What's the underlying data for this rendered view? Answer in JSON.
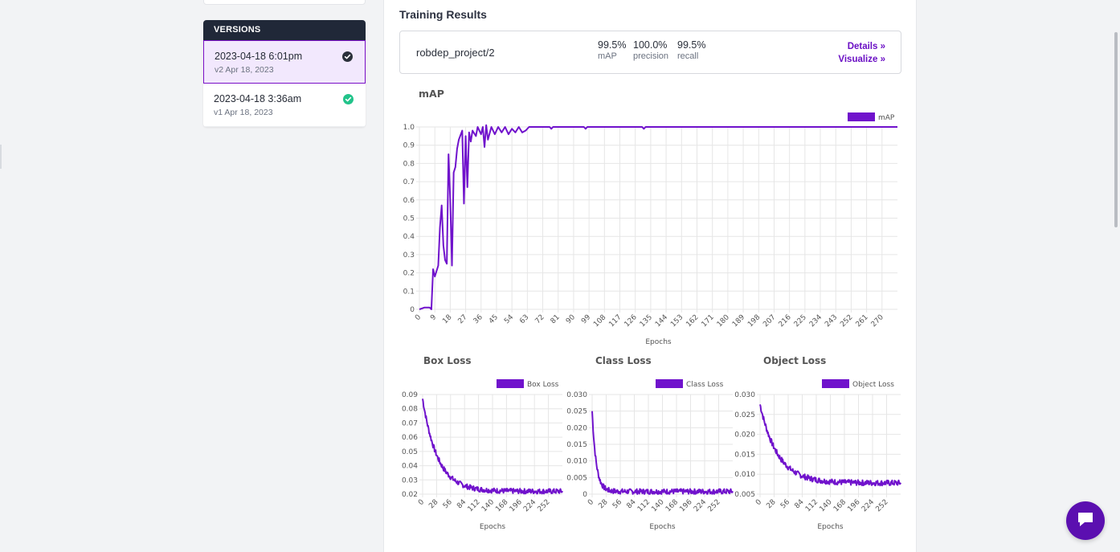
{
  "sidebar": {
    "versions_header": "VERSIONS",
    "versions": [
      {
        "date": "2023-04-18 6:01pm",
        "sub": "v2 Apr 18, 2023",
        "status": "selected"
      },
      {
        "date": "2023-04-18 3:36am",
        "sub": "v1 Apr 18, 2023",
        "status": "done"
      }
    ]
  },
  "main": {
    "title": "Training Results",
    "result": {
      "project": "robdep_project/2",
      "metrics": [
        {
          "value": "99.5%",
          "label": "mAP"
        },
        {
          "value": "100.0%",
          "label": "precision"
        },
        {
          "value": "99.5%",
          "label": "recall"
        }
      ],
      "details_link": "Details »",
      "visualize_link": "Visualize »"
    }
  },
  "colors": {
    "accent": "#6a0fc4",
    "line": "#7012cc",
    "header": "#202838",
    "success": "#22c38a"
  },
  "chart_data": [
    {
      "type": "line",
      "title": "mAP",
      "xlabel": "Epochs",
      "ylabel": "",
      "legend": "mAP",
      "legend_position": "top-right",
      "ylim": [
        0,
        1.0
      ],
      "yticks": [
        "0",
        "0.1",
        "0.2",
        "0.3",
        "0.4",
        "0.5",
        "0.6",
        "0.7",
        "0.8",
        "0.9",
        "1.0"
      ],
      "xticks": [
        "0",
        "9",
        "18",
        "27",
        "36",
        "45",
        "54",
        "63",
        "72",
        "81",
        "90",
        "99",
        "108",
        "117",
        "126",
        "135",
        "144",
        "153",
        "162",
        "171",
        "180",
        "189",
        "198",
        "207",
        "216",
        "225",
        "234",
        "243",
        "252",
        "261",
        "270"
      ],
      "xmax": 279,
      "points": [
        [
          0,
          0.0
        ],
        [
          3,
          0.01
        ],
        [
          6,
          0.01
        ],
        [
          7,
          0.0
        ],
        [
          8,
          0.22
        ],
        [
          9,
          0.18
        ],
        [
          11,
          0.24
        ],
        [
          12,
          0.45
        ],
        [
          13,
          0.57
        ],
        [
          14,
          0.35
        ],
        [
          15,
          0.27
        ],
        [
          16,
          0.25
        ],
        [
          17,
          0.85
        ],
        [
          18,
          0.6
        ],
        [
          19,
          0.24
        ],
        [
          20,
          0.75
        ],
        [
          21,
          0.78
        ],
        [
          22,
          0.88
        ],
        [
          23,
          0.93
        ],
        [
          25,
          0.98
        ],
        [
          26,
          0.58
        ],
        [
          27,
          0.95
        ],
        [
          28,
          0.67
        ],
        [
          29,
          0.97
        ],
        [
          30,
          0.92
        ],
        [
          31,
          0.98
        ],
        [
          33,
          0.95
        ],
        [
          34,
          1.0
        ],
        [
          36,
          0.96
        ],
        [
          37,
          1.0
        ],
        [
          38,
          0.89
        ],
        [
          39,
          1.01
        ],
        [
          40,
          0.93
        ],
        [
          42,
          1.0
        ],
        [
          44,
          0.96
        ],
        [
          46,
          1.0
        ],
        [
          48,
          0.97
        ],
        [
          50,
          1.0
        ],
        [
          52,
          0.96
        ],
        [
          54,
          0.99
        ],
        [
          56,
          0.97
        ],
        [
          58,
          1.0
        ],
        [
          60,
          0.97
        ],
        [
          62,
          0.98
        ],
        [
          64,
          1.0
        ],
        [
          72,
          1.0
        ],
        [
          76,
          1.0
        ],
        [
          77,
          0.99
        ],
        [
          78,
          1.0
        ],
        [
          96,
          1.0
        ],
        [
          97,
          0.99
        ],
        [
          98,
          1.0
        ],
        [
          130,
          1.0
        ],
        [
          131,
          0.99
        ],
        [
          132,
          1.0
        ],
        [
          279,
          1.0
        ]
      ]
    },
    {
      "type": "line",
      "title": "Box Loss",
      "xlabel": "Epochs",
      "legend": "Box Loss",
      "legend_position": "top-right",
      "ylim": [
        0.02,
        0.09
      ],
      "yticks": [
        "0.09",
        "0.08",
        "0.07",
        "0.06",
        "0.05",
        "0.04",
        "0.03",
        "0.02"
      ],
      "xticks": [
        "0",
        "28",
        "56",
        "84",
        "112",
        "140",
        "168",
        "196",
        "224",
        "252"
      ],
      "xmax": 280,
      "start": 0.087,
      "end": 0.022,
      "decay": 30,
      "noise": 0.0018
    },
    {
      "type": "line",
      "title": "Class Loss",
      "xlabel": "Epochs",
      "legend": "Class Loss",
      "legend_position": "top-right",
      "ylim": [
        0,
        0.03
      ],
      "yticks": [
        "0.030",
        "0.025",
        "0.020",
        "0.015",
        "0.010",
        "0.005",
        "0"
      ],
      "xticks": [
        "0",
        "28",
        "56",
        "84",
        "112",
        "140",
        "168",
        "196",
        "224",
        "252"
      ],
      "xmax": 280,
      "start": 0.025,
      "end": 0.0008,
      "decay": 8,
      "noise": 0.0008
    },
    {
      "type": "line",
      "title": "Object Loss",
      "xlabel": "Epochs",
      "legend": "Object Loss",
      "legend_position": "top-right",
      "ylim": [
        0.005,
        0.03
      ],
      "yticks": [
        "0.030",
        "0.025",
        "0.020",
        "0.015",
        "0.010",
        "0.005"
      ],
      "xticks": [
        "0",
        "28",
        "56",
        "84",
        "112",
        "140",
        "168",
        "196",
        "224",
        "252"
      ],
      "xmax": 280,
      "start": 0.0275,
      "end": 0.0078,
      "decay": 35,
      "noise": 0.0007
    }
  ]
}
